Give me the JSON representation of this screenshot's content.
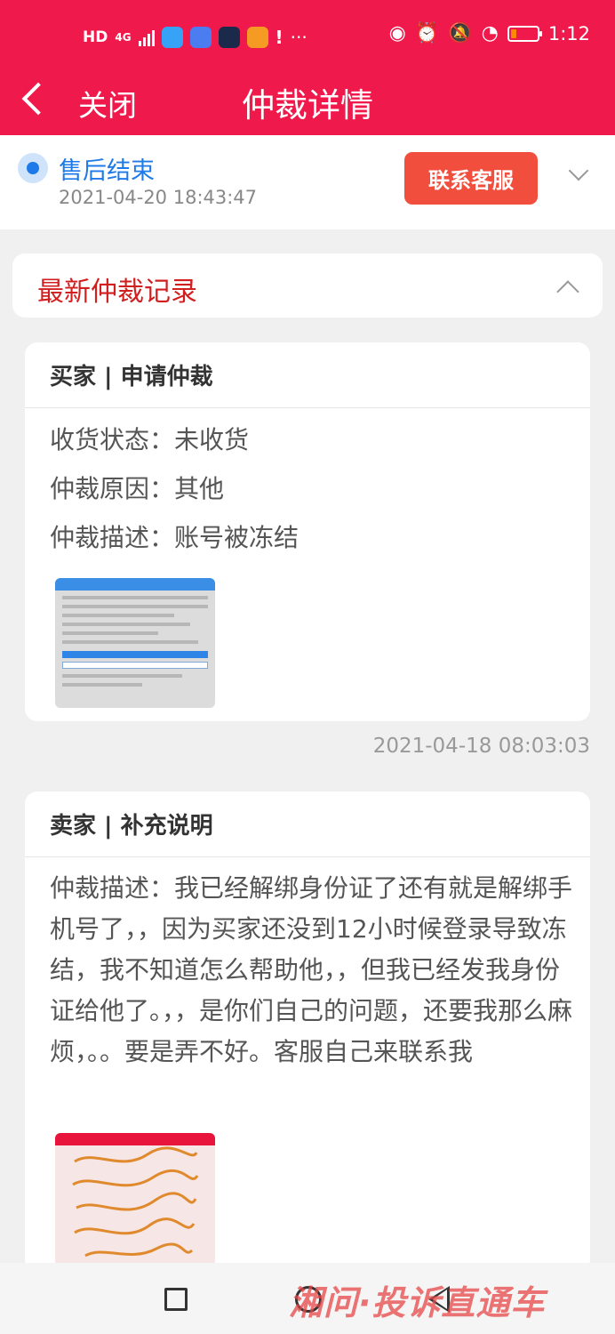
{
  "status_bar": {
    "network": "HD",
    "signal_type": "4G",
    "more": "···",
    "time": "1:12",
    "icons": [
      "eye-icon",
      "alarm-icon",
      "bell-off-icon",
      "speed-icon"
    ],
    "battery_level": 0.2,
    "colors": {
      "battery": "#ff8a00"
    }
  },
  "header": {
    "close_label": "关闭",
    "title": "仲裁详情",
    "background": "#f0194b"
  },
  "status_section": {
    "state": "售后结束",
    "time": "2021-04-20 18:43:47",
    "contact_button": "联系客服",
    "accent": "#1e7ae8",
    "button_color": "#f24e3e"
  },
  "latest": {
    "title": "最新仲裁记录",
    "title_color": "#d11f1f"
  },
  "records": [
    {
      "header": "买家 | 申请仲裁",
      "lines": [
        "收货状态：未收货",
        "仲裁原因：其他",
        "仲裁描述：账号被冻结"
      ],
      "time": "2021-04-18 08:03:03"
    },
    {
      "header": "卖家 | 补充说明",
      "description": "仲裁描述：我已经解绑身份证了还有就是解绑手机号了，，因为买家还没到12小时候登录导致冻结，我不知道怎么帮助他，，但我已经发我身份证给他了。，，是你们自己的问题，还要我那么麻烦，。。要是弄不好。客服自己来联系我"
    }
  ],
  "watermark": "湘问·投诉直通车"
}
